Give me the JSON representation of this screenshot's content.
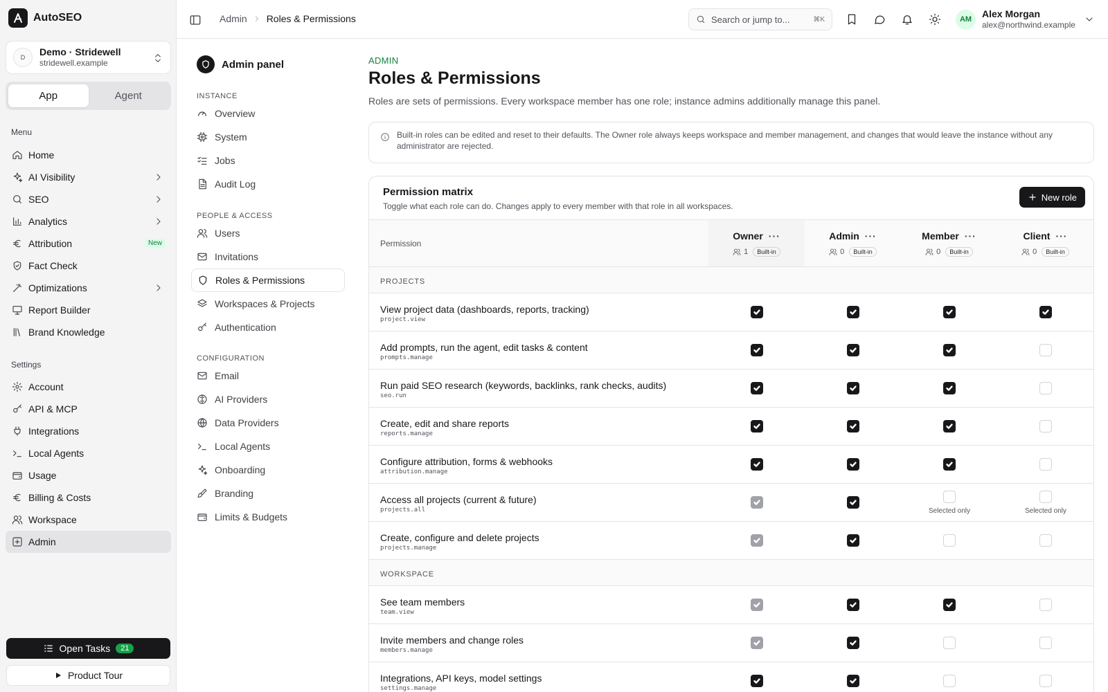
{
  "app": {
    "name": "AutoSEO"
  },
  "workspace": {
    "avatar": "D",
    "name": "Demo · Stridewell",
    "domain": "stridewell.example"
  },
  "mode_tabs": [
    {
      "label": "App",
      "active": true
    },
    {
      "label": "Agent",
      "active": false
    }
  ],
  "sidebar": {
    "menu_heading": "Menu",
    "menu": [
      {
        "label": "Home",
        "icon": "home-icon"
      },
      {
        "label": "AI Visibility",
        "icon": "sparkles-icon",
        "chevron": true
      },
      {
        "label": "SEO",
        "icon": "search-icon",
        "chevron": true
      },
      {
        "label": "Analytics",
        "icon": "bar-chart-icon",
        "chevron": true
      },
      {
        "label": "Attribution",
        "icon": "euro-icon",
        "badge": "New"
      },
      {
        "label": "Fact Check",
        "icon": "shield-check-icon"
      },
      {
        "label": "Optimizations",
        "icon": "wand-icon",
        "chevron": true
      },
      {
        "label": "Report Builder",
        "icon": "presentation-icon"
      },
      {
        "label": "Brand Knowledge",
        "icon": "library-icon"
      }
    ],
    "settings_heading": "Settings",
    "settings": [
      {
        "label": "Account",
        "icon": "gear-icon"
      },
      {
        "label": "API & MCP",
        "icon": "key-icon"
      },
      {
        "label": "Integrations",
        "icon": "plug-icon"
      },
      {
        "label": "Local Agents",
        "icon": "terminal-icon"
      },
      {
        "label": "Usage",
        "icon": "wallet-icon"
      },
      {
        "label": "Billing & Costs",
        "icon": "euro-icon"
      },
      {
        "label": "Workspace",
        "icon": "users-icon"
      },
      {
        "label": "Admin",
        "icon": "admin-icon",
        "active": true
      }
    ],
    "open_tasks": {
      "label": "Open Tasks",
      "count": "21"
    },
    "product_tour": {
      "label": "Product Tour"
    }
  },
  "topbar": {
    "breadcrumb": [
      "Admin",
      "Roles & Permissions"
    ],
    "search_placeholder": "Search or jump to...",
    "search_shortcut": "⌘K",
    "user": {
      "initials": "AM",
      "name": "Alex Morgan",
      "email": "alex@northwind.example"
    }
  },
  "admin_nav": {
    "title": "Admin panel",
    "sections": [
      {
        "heading": "INSTANCE",
        "items": [
          {
            "label": "Overview",
            "icon": "gauge-icon"
          },
          {
            "label": "System",
            "icon": "cpu-icon"
          },
          {
            "label": "Jobs",
            "icon": "list-checks-icon"
          },
          {
            "label": "Audit Log",
            "icon": "file-text-icon"
          }
        ]
      },
      {
        "heading": "PEOPLE & ACCESS",
        "items": [
          {
            "label": "Users",
            "icon": "users-icon"
          },
          {
            "label": "Invitations",
            "icon": "mail-icon"
          },
          {
            "label": "Roles & Permissions",
            "icon": "shield-icon",
            "active": true
          },
          {
            "label": "Workspaces & Projects",
            "icon": "layers-icon"
          },
          {
            "label": "Authentication",
            "icon": "key-icon"
          }
        ]
      },
      {
        "heading": "CONFIGURATION",
        "items": [
          {
            "label": "Email",
            "icon": "mail-icon"
          },
          {
            "label": "AI Providers",
            "icon": "brain-icon"
          },
          {
            "label": "Data Providers",
            "icon": "globe-icon"
          },
          {
            "label": "Local Agents",
            "icon": "terminal-icon"
          },
          {
            "label": "Onboarding",
            "icon": "sparkles-icon"
          },
          {
            "label": "Branding",
            "icon": "brush-icon"
          },
          {
            "label": "Limits & Budgets",
            "icon": "wallet-icon"
          }
        ]
      }
    ]
  },
  "page": {
    "eyebrow": "ADMIN",
    "title": "Roles & Permissions",
    "subtitle": "Roles are sets of permissions. Every workspace member has one role; instance admins additionally manage this panel.",
    "notice": "Built-in roles can be edited and reset to their defaults. The Owner role always keeps workspace and member management, and changes that would leave the instance without any administrator are rejected."
  },
  "matrix": {
    "title": "Permission matrix",
    "subtitle": "Toggle what each role can do. Changes apply to every member with that role in all workspaces.",
    "new_role_label": "New role",
    "permission_header": "Permission",
    "roles": [
      {
        "name": "Owner",
        "members": "1",
        "badge": "Built-in"
      },
      {
        "name": "Admin",
        "members": "0",
        "badge": "Built-in"
      },
      {
        "name": "Member",
        "members": "0",
        "badge": "Built-in"
      },
      {
        "name": "Client",
        "members": "0",
        "badge": "Built-in"
      }
    ],
    "sections": [
      {
        "title": "PROJECTS",
        "rows": [
          {
            "label": "View project data (dashboards, reports, tracking)",
            "key": "project.view",
            "cells": [
              "on",
              "on",
              "on",
              "on"
            ]
          },
          {
            "label": "Add prompts, run the agent, edit tasks & content",
            "key": "prompts.manage",
            "cells": [
              "on",
              "on",
              "on",
              "off"
            ]
          },
          {
            "label": "Run paid SEO research (keywords, backlinks, rank checks, audits)",
            "key": "seo.run",
            "cells": [
              "on",
              "on",
              "on",
              "off"
            ]
          },
          {
            "label": "Create, edit and share reports",
            "key": "reports.manage",
            "cells": [
              "on",
              "on",
              "on",
              "off"
            ]
          },
          {
            "label": "Configure attribution, forms & webhooks",
            "key": "attribution.manage",
            "cells": [
              "on",
              "on",
              "on",
              "off"
            ]
          },
          {
            "label": "Access all projects (current & future)",
            "key": "projects.all",
            "cells": [
              "locked",
              "on",
              "off",
              "off"
            ],
            "notes": [
              "",
              "",
              "Selected only",
              "Selected only"
            ]
          },
          {
            "label": "Create, configure and delete projects",
            "key": "projects.manage",
            "cells": [
              "locked",
              "on",
              "off",
              "off"
            ]
          }
        ]
      },
      {
        "title": "WORKSPACE",
        "rows": [
          {
            "label": "See team members",
            "key": "team.view",
            "cells": [
              "locked",
              "on",
              "on",
              "off"
            ]
          },
          {
            "label": "Invite members and change roles",
            "key": "members.manage",
            "cells": [
              "locked",
              "on",
              "off",
              "off"
            ]
          },
          {
            "label": "Integrations, API keys, model settings",
            "key": "settings.manage",
            "cells": [
              "on",
              "on",
              "off",
              "off"
            ]
          }
        ]
      }
    ]
  }
}
